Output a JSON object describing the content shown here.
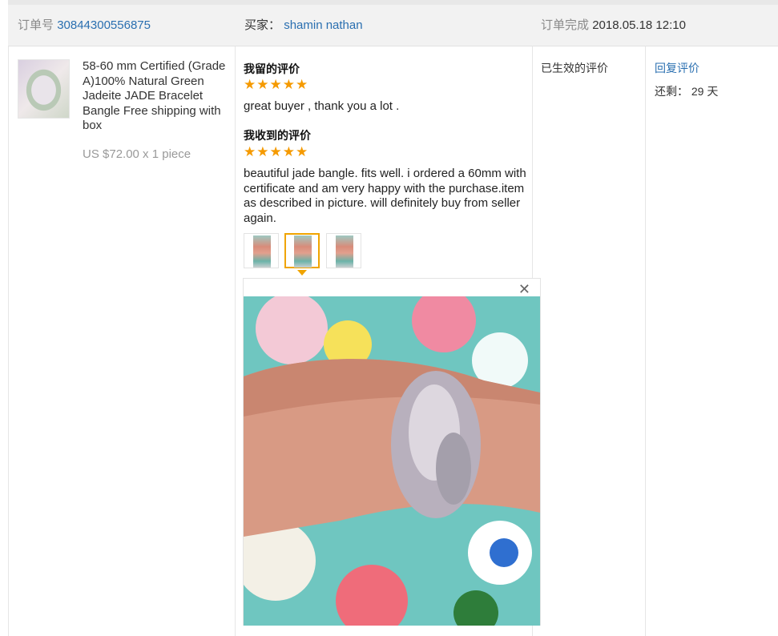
{
  "order": {
    "number_label": "订单号",
    "number": "30844300556875",
    "buyer_label": "买家：",
    "buyer": "shamin nathan",
    "completed_label": "订单完成",
    "completed_time": "2018.05.18 12:10"
  },
  "product": {
    "title": "58-60 mm Certified (Grade A)100% Natural Green Jadeite JADE Bracelet Bangle Free shipping with box",
    "price": "US $72.00 x 1 piece"
  },
  "my_review": {
    "heading": "我留的评价",
    "stars": "★★★★★",
    "text": "great buyer , thank you a lot ."
  },
  "received_review": {
    "heading": "我收到的评价",
    "stars": "★★★★★",
    "text": "beautiful jade bangle. fits well. i ordered a 60mm with certificate and am very happy with the purchase.item as described in picture. will definitely buy from seller again."
  },
  "status": {
    "label": "已生效的评价"
  },
  "actions": {
    "reply": "回复评价",
    "remaining_label": "还剩：",
    "remaining_days": "29 天"
  },
  "viewer": {
    "close_icon": "✕",
    "selected_photo": 2,
    "photo_count": 3
  },
  "colors": {
    "link": "#2a6fb0",
    "stars": "#f59a00",
    "active_border": "#f0a400"
  }
}
